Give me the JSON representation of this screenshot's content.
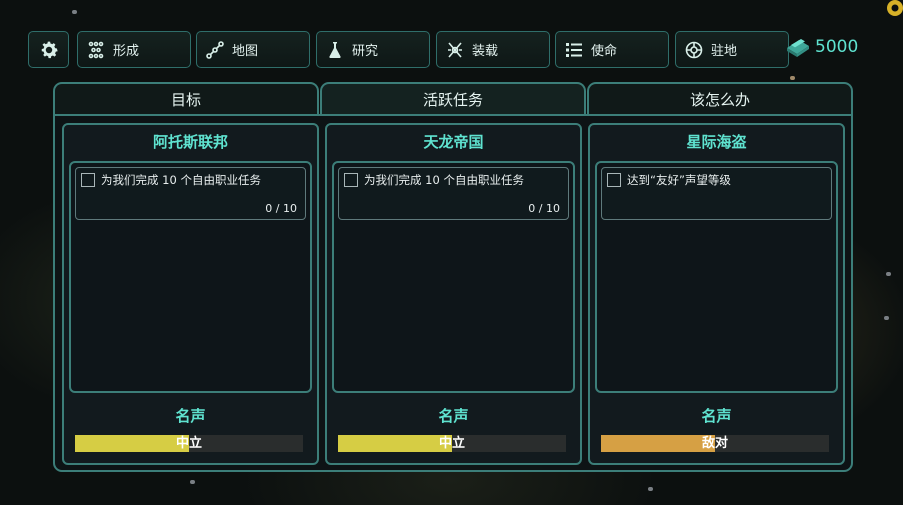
{
  "toolbar": {
    "items": [
      {
        "label": "",
        "icon": "gear-icon"
      },
      {
        "label": "形成",
        "icon": "formation-icon"
      },
      {
        "label": "地图",
        "icon": "map-icon"
      },
      {
        "label": "研究",
        "icon": "flask-icon"
      },
      {
        "label": "装载",
        "icon": "loadout-icon"
      },
      {
        "label": "使命",
        "icon": "list-icon"
      },
      {
        "label": "驻地",
        "icon": "station-icon"
      }
    ],
    "credits": "5000"
  },
  "tabs": [
    {
      "label": "目标",
      "active": false
    },
    {
      "label": "活跃任务",
      "active": true
    },
    {
      "label": "该怎么办",
      "active": false
    }
  ],
  "factions": [
    {
      "name": "阿托斯联邦",
      "missions": [
        {
          "text": "为我们完成 10 个自由职业任务",
          "progress": "0 / 10"
        }
      ],
      "reputation_label": "名声",
      "reputation": {
        "value": "中立",
        "level": 0.5,
        "color": "#d6cd44"
      }
    },
    {
      "name": "天龙帝国",
      "missions": [
        {
          "text": "为我们完成 10 个自由职业任务",
          "progress": "0 / 10"
        }
      ],
      "reputation_label": "名声",
      "reputation": {
        "value": "中立",
        "level": 0.5,
        "color": "#d6cd44"
      }
    },
    {
      "name": "星际海盗",
      "missions": [
        {
          "text": "达到“友好”声望等级",
          "progress": ""
        }
      ],
      "reputation_label": "名声",
      "reputation": {
        "value": "敌对",
        "level": 0.5,
        "color": "#d6a044"
      }
    }
  ],
  "colors": {
    "accent": "#5fe3d0",
    "frame": "#3c7e79"
  }
}
